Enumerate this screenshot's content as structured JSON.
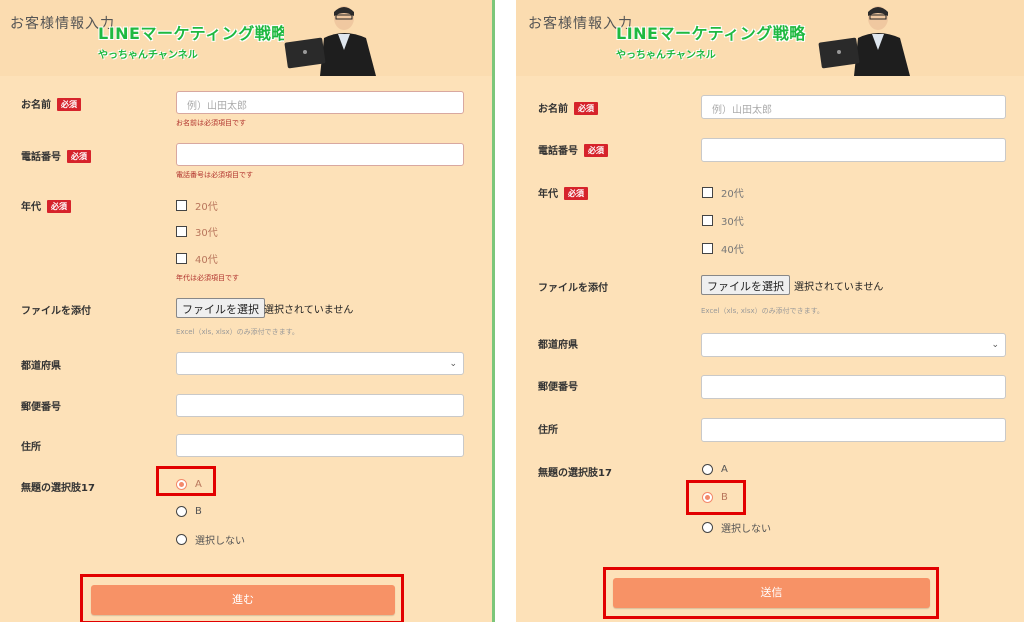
{
  "left": {
    "form_title": "お客様情報入力",
    "banner_title": "LINEマーケティング戦略",
    "banner_sub": "やっちゃんチャンネル",
    "name_label": "お名前",
    "required": "必須",
    "name_placeholder": "例）山田太郎",
    "name_error": "お名前は必須項目です",
    "phone_label": "電話番号",
    "phone_error": "電話番号は必須項目です",
    "age_label": "年代",
    "age_options": [
      "20代",
      "30代",
      "40代"
    ],
    "age_error": "年代は必須項目です",
    "file_label": "ファイルを添付",
    "file_button": "ファイルを選択",
    "file_status": "選択されていません",
    "file_hint": "Excel（xls, xlsx）のみ添付できます。",
    "pref_label": "都道府県",
    "zip_label": "郵便番号",
    "address_label": "住所",
    "choice_label": "無題の選択肢17",
    "choice_options": [
      "A",
      "B",
      "選択しない"
    ],
    "choice_selected": "A",
    "submit_label": "進む"
  },
  "right": {
    "form_title": "お客様情報入力",
    "banner_title": "LINEマーケティング戦略",
    "banner_sub": "やっちゃんチャンネル",
    "name_label": "お名前",
    "required": "必須",
    "name_placeholder": "例）山田太郎",
    "phone_label": "電話番号",
    "age_label": "年代",
    "age_options": [
      "20代",
      "30代",
      "40代"
    ],
    "file_label": "ファイルを添付",
    "file_button": "ファイルを選択",
    "file_status": "選択されていません",
    "file_hint": "Excel（xls, xlsx）のみ添付できます。",
    "pref_label": "都道府県",
    "zip_label": "郵便番号",
    "address_label": "住所",
    "choice_label": "無題の選択肢17",
    "choice_options": [
      "A",
      "B",
      "選択しない"
    ],
    "choice_selected": "B",
    "submit_label": "送信"
  },
  "colors": {
    "panel_bg": "#fde1b8",
    "required_badge": "#d6232b",
    "error_text": "#b0312c",
    "submit_button": "#f79266",
    "highlight_box": "#e20000",
    "divider": "#7cc67a",
    "banner_text": "#1fb941"
  }
}
